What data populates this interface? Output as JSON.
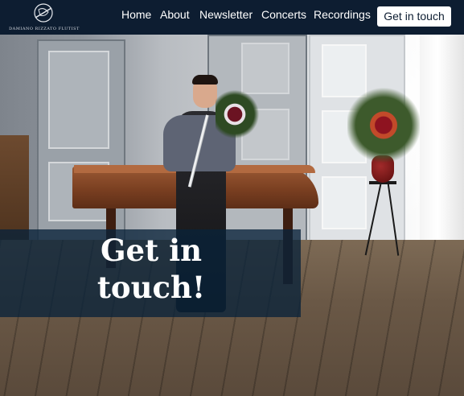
{
  "brand": {
    "logo_text": "DAMIANO RIZZATO FLUTIST"
  },
  "nav": {
    "items": [
      {
        "label": "Home"
      },
      {
        "label": "About"
      },
      {
        "label": "Newsletter"
      },
      {
        "label": "Concerts"
      },
      {
        "label": "Recordings"
      }
    ],
    "cta_label": "Get in touch"
  },
  "hero": {
    "title": "Get in touch!",
    "banner_color": "#09223a"
  },
  "colors": {
    "navbar_bg": "#0d1d31",
    "cta_bg": "#ffffff",
    "nav_text": "#ffffff"
  },
  "icons": {
    "logo": "flute-emblem-icon"
  }
}
